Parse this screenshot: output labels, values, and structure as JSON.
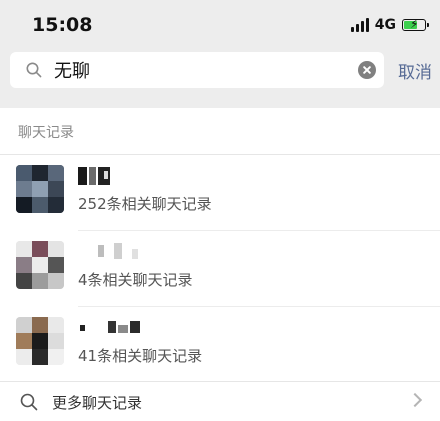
{
  "status_bar": {
    "time": "15:08",
    "network": "4G",
    "battery_level": 0.6,
    "battery_color": "#3ccf4e"
  },
  "search": {
    "query": "无聊",
    "cancel_label": "取消",
    "search_icon": "search-icon",
    "clear_icon": "clear-icon"
  },
  "results": {
    "section_title": "聊天记录",
    "items": [
      {
        "count_text": "252条相关聊天记录"
      },
      {
        "count_text": "4条相关聊天记录"
      },
      {
        "count_text": "41条相关聊天记录"
      }
    ],
    "more_label": "更多聊天记录",
    "more_icon": "search-icon",
    "chevron_icon": "chevron-right-icon"
  },
  "colors": {
    "link": "#576b95",
    "background": "#ededed",
    "secondary_text": "#8a8a8a"
  }
}
